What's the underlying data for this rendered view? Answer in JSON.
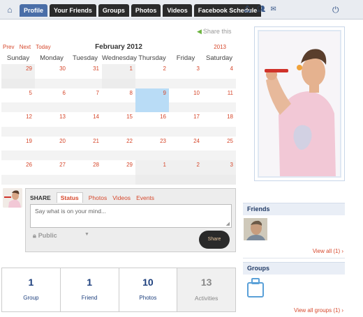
{
  "nav": {
    "home_icon": "home-icon",
    "tabs": [
      "Profile",
      "Your Friends",
      "Groups",
      "Photos",
      "Videos",
      "Facebook Schedule"
    ],
    "active_tab": "Profile",
    "icons": [
      "bell-icon",
      "people-icon",
      "inbox-icon"
    ],
    "power_icon": "power-icon"
  },
  "share_this": {
    "label": "Share this",
    "icon": "share-icon"
  },
  "calendar": {
    "prev": "Prev",
    "next": "Next",
    "today": "Today",
    "month_title": "February 2012",
    "year_link": "2013",
    "weekdays": [
      "Sunday",
      "Monday",
      "Tuesday",
      "Wednesday",
      "Thursday",
      "Friday",
      "Saturday"
    ],
    "weeks": [
      [
        "29",
        "30",
        "31",
        "1",
        "2",
        "3",
        "4"
      ],
      [
        "5",
        "6",
        "7",
        "8",
        "9",
        "10",
        "11"
      ],
      [
        "12",
        "13",
        "14",
        "15",
        "16",
        "17",
        "18"
      ],
      [
        "19",
        "20",
        "21",
        "22",
        "23",
        "24",
        "25"
      ],
      [
        "26",
        "27",
        "28",
        "29",
        "1",
        "2",
        "3"
      ]
    ],
    "selected_day": "9"
  },
  "sharebox": {
    "label": "SHARE",
    "tabs": [
      "Status",
      "Photos",
      "Videos",
      "Events"
    ],
    "active_tab": "Status",
    "placeholder": "Say what is on your mind...",
    "privacy": "Public",
    "post_button": "Share"
  },
  "friends": {
    "title": "Friends",
    "view_all": "View all (1) ›"
  },
  "groups": {
    "title": "Groups",
    "view_all": "View all groups (1) ›",
    "icon": "group-icon"
  },
  "stats": [
    {
      "value": "1",
      "label": "Group"
    },
    {
      "value": "1",
      "label": "Friend"
    },
    {
      "value": "10",
      "label": "Photos"
    },
    {
      "value": "13",
      "label": "Activities"
    }
  ],
  "colors": {
    "accent": "#d6472b",
    "nav_active": "#4a6ea8",
    "link_blue": "#1d3f7d",
    "selected_cell": "#b9dcf6"
  }
}
